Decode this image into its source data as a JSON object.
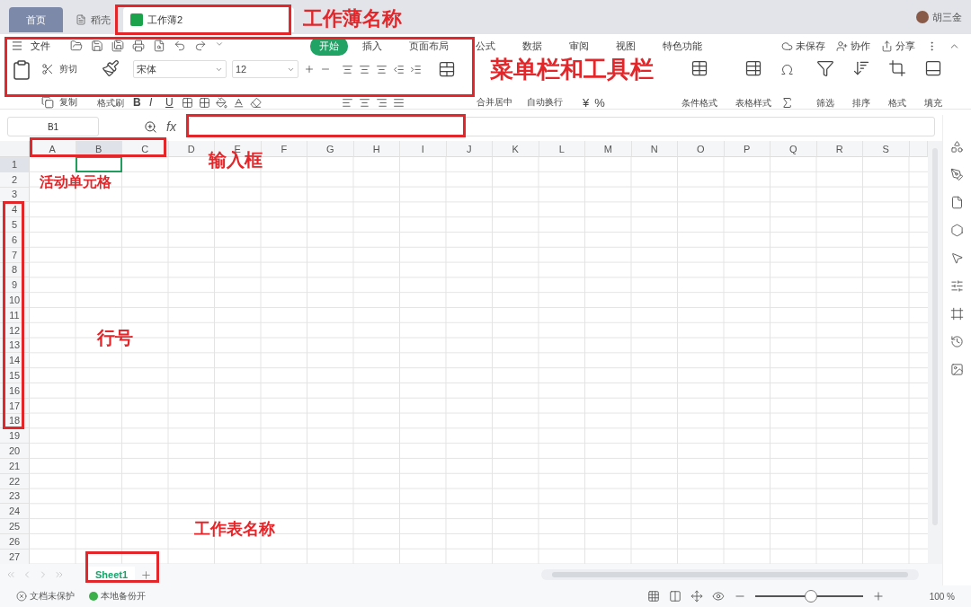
{
  "title_bar": {
    "tabs": [
      {
        "kind": "home",
        "label": "首页",
        "selected": false
      },
      {
        "kind": "store",
        "label": "稻壳",
        "selected": false
      },
      {
        "kind": "document",
        "label": "工作薄2",
        "selected": true
      }
    ],
    "user": "胡三金"
  },
  "menu_bar": {
    "file": "文件",
    "tabs": [
      {
        "label": "开始",
        "selected": true
      },
      {
        "label": "插入",
        "selected": false
      },
      {
        "label": "页面布局",
        "selected": false
      },
      {
        "label": "公式",
        "selected": false
      },
      {
        "label": "数据",
        "selected": false
      },
      {
        "label": "审阅",
        "selected": false
      },
      {
        "label": "视图",
        "selected": false
      },
      {
        "label": "特色功能",
        "selected": false
      }
    ],
    "actions": [
      "未保存",
      "协作",
      "分享"
    ]
  },
  "toolbar": {
    "cut": "剪切",
    "copy": "复制",
    "format_painter": "格式刷",
    "font": "宋体",
    "font_size": "12",
    "font_styles": [
      "B",
      "I",
      "U"
    ],
    "merge": "合并居中",
    "wrap": "自动换行",
    "number_symbols": [
      "¥",
      "%"
    ],
    "buttons": [
      {
        "kind": "conditional",
        "label": "条件格式"
      },
      {
        "kind": "table-style",
        "label": "表格样式"
      },
      {
        "kind": "filter",
        "label": "筛选"
      },
      {
        "kind": "sort",
        "label": "排序"
      },
      {
        "kind": "format",
        "label": "格式"
      },
      {
        "kind": "fill",
        "label": "填充"
      }
    ]
  },
  "formula_bar": {
    "name_box": "B1",
    "fx": "fx"
  },
  "columns": [
    {
      "label": "A",
      "selected": false
    },
    {
      "label": "B",
      "selected": true
    },
    {
      "label": "C",
      "selected": false
    },
    {
      "label": "D",
      "selected": false
    },
    {
      "label": "E",
      "selected": false
    },
    {
      "label": "F",
      "selected": false
    },
    {
      "label": "G",
      "selected": false
    },
    {
      "label": "H",
      "selected": false
    },
    {
      "label": "I",
      "selected": false
    },
    {
      "label": "J",
      "selected": false
    },
    {
      "label": "K",
      "selected": false
    },
    {
      "label": "L",
      "selected": false
    },
    {
      "label": "M",
      "selected": false
    },
    {
      "label": "N",
      "selected": false
    },
    {
      "label": "O",
      "selected": false
    },
    {
      "label": "P",
      "selected": false
    },
    {
      "label": "Q",
      "selected": false
    },
    {
      "label": "R",
      "selected": false
    },
    {
      "label": "S",
      "selected": false
    }
  ],
  "rows": [
    {
      "label": "1",
      "selected": true
    },
    {
      "label": "2",
      "selected": false
    },
    {
      "label": "3",
      "selected": false
    },
    {
      "label": "4",
      "selected": false
    },
    {
      "label": "5",
      "selected": false
    },
    {
      "label": "6",
      "selected": false
    },
    {
      "label": "7",
      "selected": false
    },
    {
      "label": "8",
      "selected": false
    },
    {
      "label": "9",
      "selected": false
    },
    {
      "label": "10",
      "selected": false
    },
    {
      "label": "11",
      "selected": false
    },
    {
      "label": "12",
      "selected": false
    },
    {
      "label": "13",
      "selected": false
    },
    {
      "label": "14",
      "selected": false
    },
    {
      "label": "15",
      "selected": false
    },
    {
      "label": "16",
      "selected": false
    },
    {
      "label": "17",
      "selected": false
    },
    {
      "label": "18",
      "selected": false
    },
    {
      "label": "19",
      "selected": false
    },
    {
      "label": "20",
      "selected": false
    },
    {
      "label": "21",
      "selected": false
    },
    {
      "label": "22",
      "selected": false
    },
    {
      "label": "23",
      "selected": false
    },
    {
      "label": "24",
      "selected": false
    },
    {
      "label": "25",
      "selected": false
    },
    {
      "label": "26",
      "selected": false
    },
    {
      "label": "27",
      "selected": false
    }
  ],
  "sheet_tabs": [
    {
      "label": "Sheet1",
      "selected": true
    }
  ],
  "status_bar": {
    "protection": "文档未保护",
    "backup": "本地备份开",
    "zoom": {
      "level": 0.52
    },
    "zoom_reading": "100 %"
  },
  "annotations": [
    "工作薄名称",
    "菜单栏和工具栏",
    "输入框",
    "活动单元格",
    "行号",
    "工作表名称"
  ]
}
